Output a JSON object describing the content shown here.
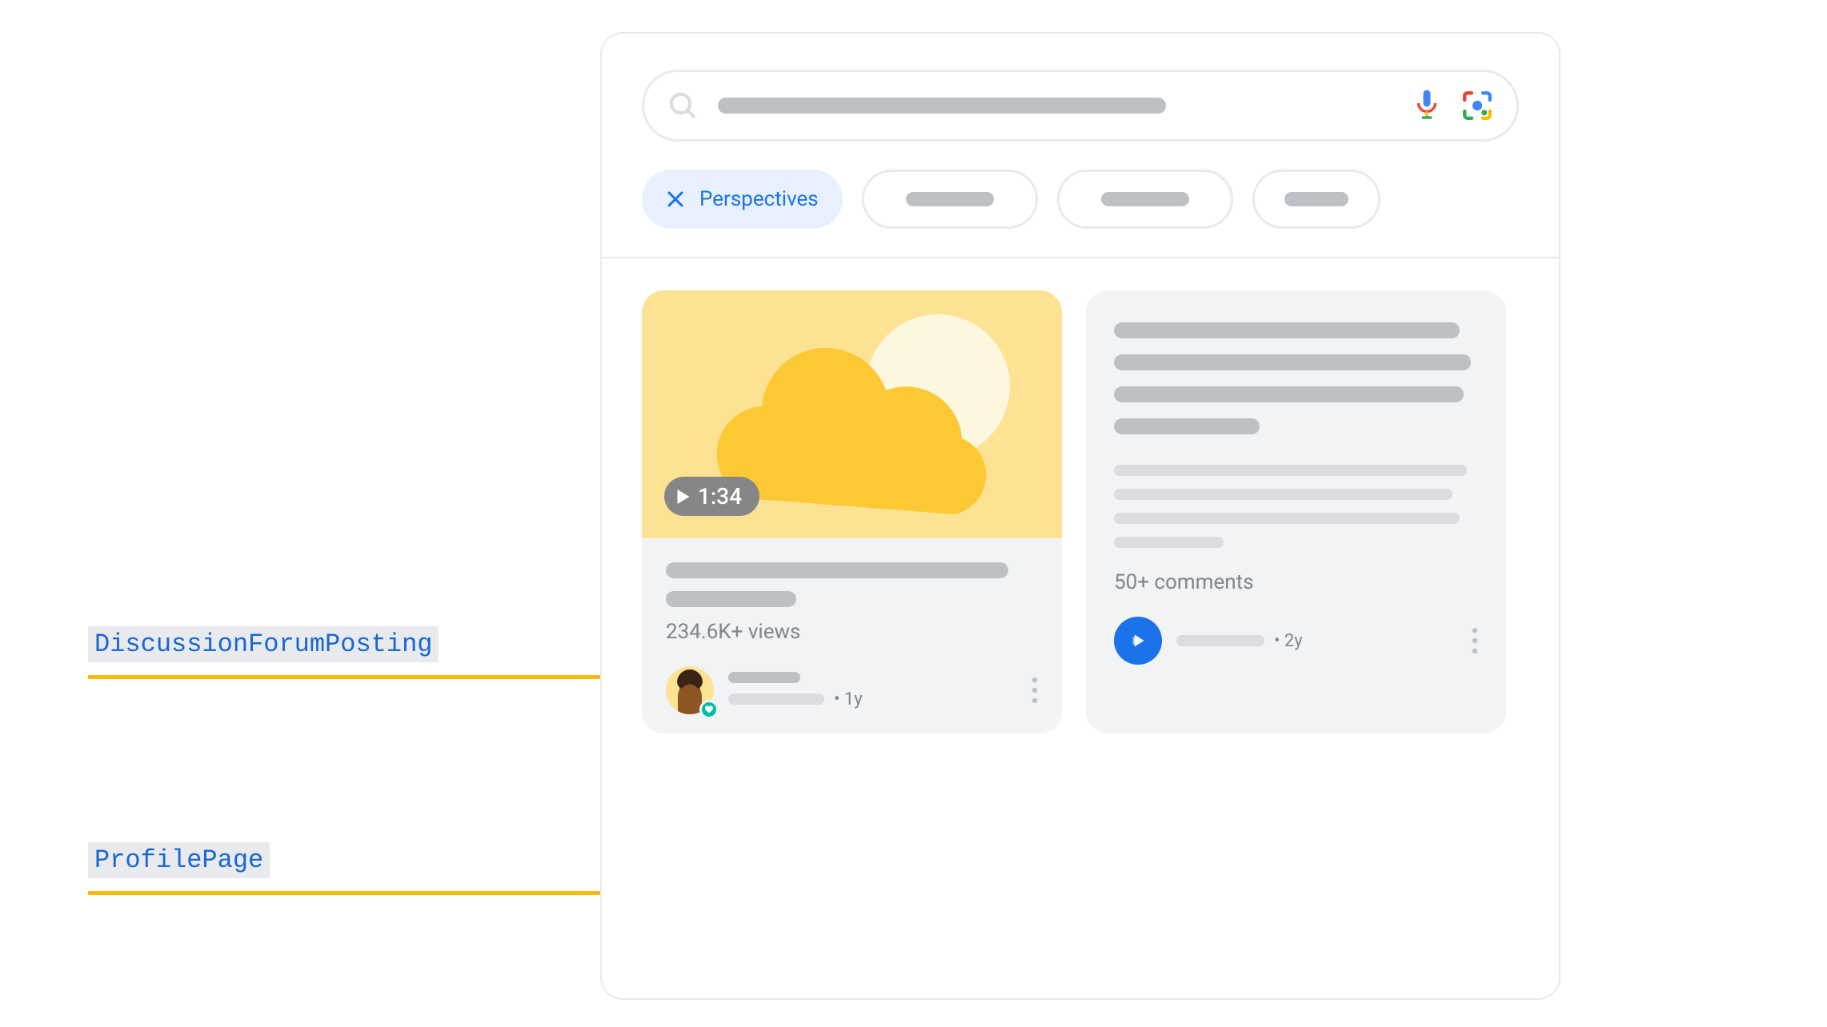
{
  "annotations": {
    "discussion": "DiscussionForumPosting",
    "profile": "ProfilePage"
  },
  "tabs": {
    "active": "Perspectives"
  },
  "card1": {
    "duration": "1:34",
    "meta": "234.6K+ views",
    "timestamp": "1y"
  },
  "card2": {
    "meta": "50+ comments",
    "timestamp": "2y"
  },
  "colors": {
    "blue": "#1a73e8",
    "orange": "#fbbc04",
    "teal": "#00bfa5",
    "thumb": "#fde293"
  }
}
